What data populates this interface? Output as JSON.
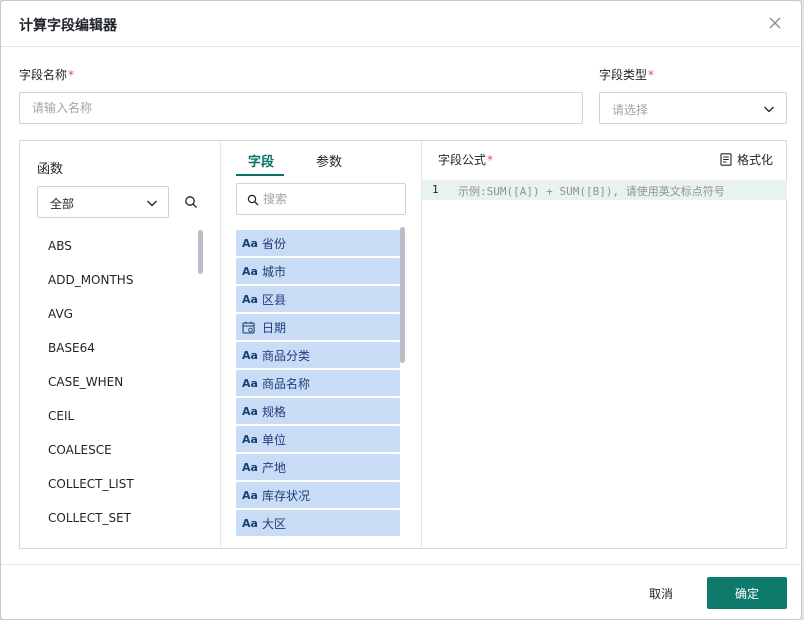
{
  "dialog": {
    "title": "计算字段编辑器"
  },
  "form": {
    "name_label": "字段名称",
    "name_required": "*",
    "name_placeholder": "请输入名称",
    "type_label": "字段类型",
    "type_required": "*",
    "type_placeholder": "请选择"
  },
  "functions": {
    "title": "函数",
    "category_selected": "全部",
    "items": [
      "ABS",
      "ADD_MONTHS",
      "AVG",
      "BASE64",
      "CASE_WHEN",
      "CEIL",
      "COALESCE",
      "COLLECT_LIST",
      "COLLECT_SET"
    ]
  },
  "fields": {
    "tabs": [
      {
        "label": "字段",
        "active": true
      },
      {
        "label": "参数",
        "active": false
      }
    ],
    "search_placeholder": "搜索",
    "items": [
      {
        "type": "text",
        "type_label": "Aa",
        "name": "省份"
      },
      {
        "type": "text",
        "type_label": "Aa",
        "name": "城市"
      },
      {
        "type": "text",
        "type_label": "Aa",
        "name": "区县"
      },
      {
        "type": "date",
        "type_label": "",
        "name": "日期"
      },
      {
        "type": "text",
        "type_label": "Aa",
        "name": "商品分类"
      },
      {
        "type": "text",
        "type_label": "Aa",
        "name": "商品名称"
      },
      {
        "type": "text",
        "type_label": "Aa",
        "name": "规格"
      },
      {
        "type": "text",
        "type_label": "Aa",
        "name": "单位"
      },
      {
        "type": "text",
        "type_label": "Aa",
        "name": "产地"
      },
      {
        "type": "text",
        "type_label": "Aa",
        "name": "库存状况"
      },
      {
        "type": "text",
        "type_label": "Aa",
        "name": "大区"
      }
    ]
  },
  "formula": {
    "title": "字段公式",
    "required": "*",
    "format_label": "格式化",
    "line_number": "1",
    "placeholder": "示例:SUM([A]) + SUM([B]), 请使用英文标点符号"
  },
  "footer": {
    "cancel_label": "取消",
    "ok_label": "确定"
  },
  "colors": {
    "accent": "#0f7a6c",
    "field_chip": "#c9dcf5",
    "required": "#e34d59"
  }
}
